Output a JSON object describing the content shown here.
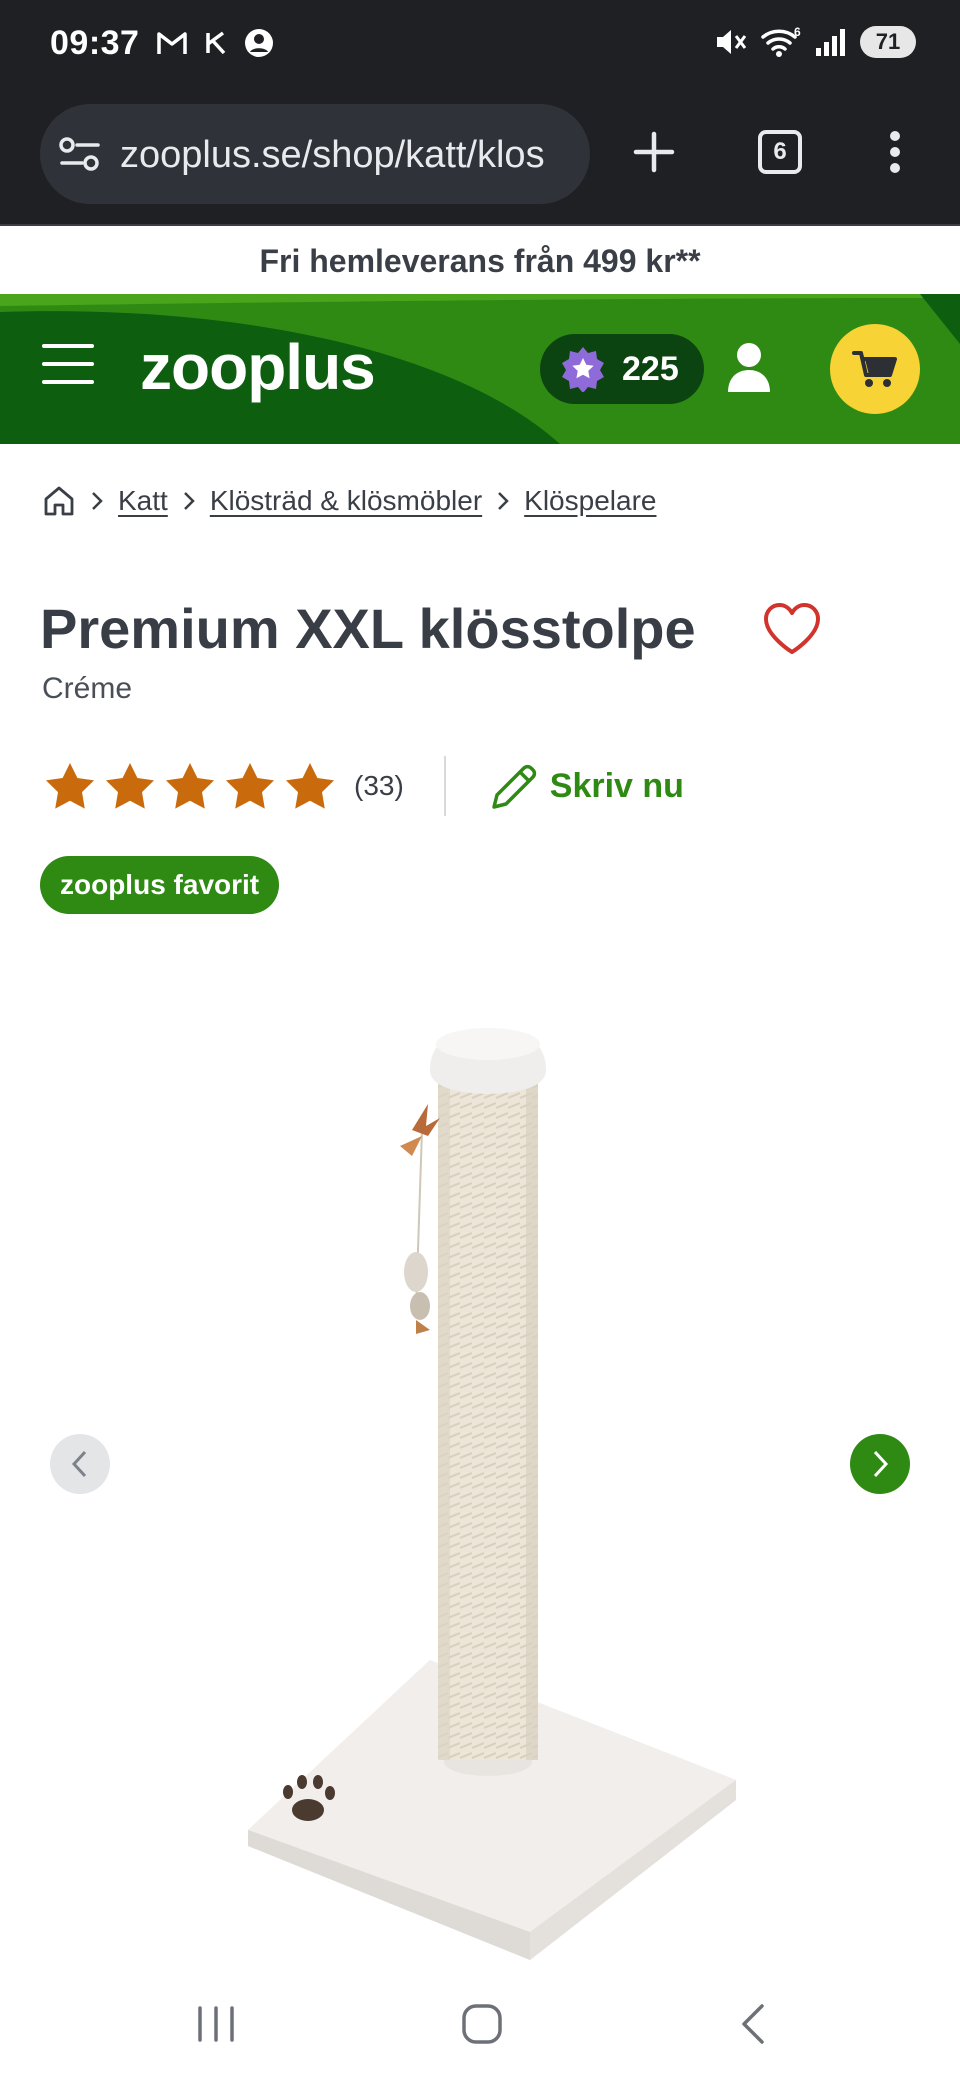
{
  "status_bar": {
    "time": "09:37",
    "left_icons": [
      "gmail-icon",
      "k-icon",
      "account-icon"
    ],
    "right_icons": [
      "mute-icon",
      "wifi-icon",
      "signal-icon"
    ],
    "battery": "71"
  },
  "browser": {
    "url": "zooplus.se/shop/katt/klos",
    "tab_count": "6"
  },
  "promo": {
    "text": "Fri hemleverans från 499 kr**"
  },
  "header": {
    "logo": "zooplus",
    "points": "225",
    "colors": {
      "primary": "#0d5e0f",
      "accent": "#2f8a14",
      "cart": "#f7d335"
    }
  },
  "breadcrumb": {
    "items": [
      "Katt",
      "Klösträd & klösmöbler",
      "Klöspelare"
    ]
  },
  "product": {
    "title": "Premium XXL klösstolpe",
    "variant": "Créme",
    "rating": 5,
    "rating_count": "(33)",
    "write_review_label": "Skriv nu",
    "badge": "zooplus favorit"
  }
}
